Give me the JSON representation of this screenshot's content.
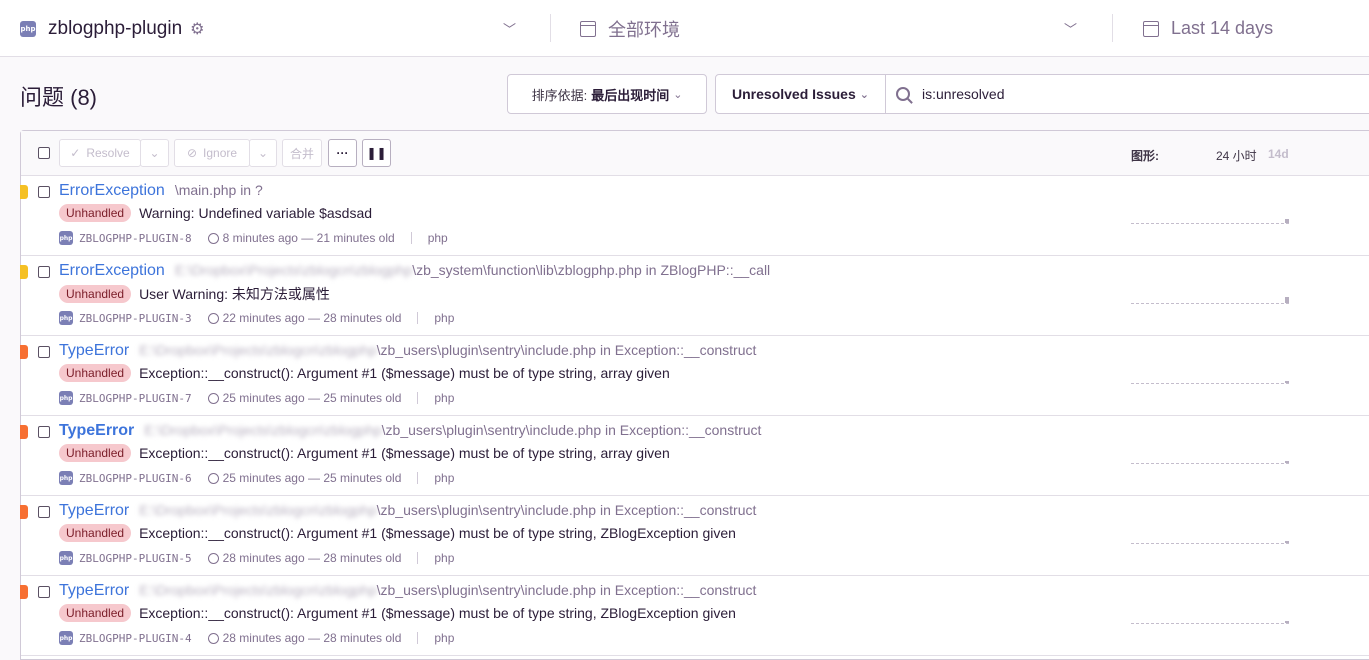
{
  "header": {
    "project_icon": "php-icon",
    "project_name": "zblogphp-plugin",
    "environment": "全部环境",
    "time_range": "Last 14 days"
  },
  "page": {
    "title": "问题 (8)"
  },
  "toolbar": {
    "sort_label": "排序依据:",
    "sort_value": "最后出现时间",
    "saved_search": "Unresolved Issues",
    "search_value": "is:unresolved"
  },
  "list_actions": {
    "resolve": "Resolve",
    "ignore": "Ignore",
    "merge": "合并",
    "more": "···",
    "graph_label": "图形:",
    "graph_24h": "24 小时",
    "graph_14d": "14d"
  },
  "colors": {
    "warning": "#f5c024",
    "error": "#f76f32",
    "link": "#3d74db",
    "badge_bg": "#f6c8cd"
  },
  "issues": [
    {
      "type": "ErrorException",
      "type_bold": false,
      "blurred": "",
      "culprit": "\\main.php in ?",
      "badge": "Unhandled",
      "message": "Warning: Undefined variable $asdsad",
      "short_id": "ZBLOGPHP-PLUGIN-8",
      "times": "8 minutes ago — 21 minutes old",
      "platform": "php",
      "level": "warning",
      "spark": 0.5
    },
    {
      "type": "ErrorException",
      "type_bold": false,
      "blurred": "E:\\Dropbox\\Projects\\zblogcn\\zblogphp",
      "culprit": "\\zb_system\\function\\lib\\zblogphp.php in ZBlogPHP::__call",
      "badge": "Unhandled",
      "message": "User Warning: 未知方法或属性",
      "short_id": "ZBLOGPHP-PLUGIN-3",
      "times": "22 minutes ago — 28 minutes old",
      "platform": "php",
      "level": "warning",
      "spark": 0.7
    },
    {
      "type": "TypeError",
      "type_bold": false,
      "blurred": "E:\\Dropbox\\Projects\\zblogcn\\zblogphp",
      "culprit": "\\zb_users\\plugin\\sentry\\include.php in Exception::__construct",
      "badge": "Unhandled",
      "message": "Exception::__construct(): Argument #1 ($message) must be of type string, array given",
      "short_id": "ZBLOGPHP-PLUGIN-7",
      "times": "25 minutes ago — 25 minutes old",
      "platform": "php",
      "level": "error",
      "spark": 0.2
    },
    {
      "type": "TypeError",
      "type_bold": true,
      "blurred": "E:\\Dropbox\\Projects\\zblogcn\\zblogphp",
      "culprit": "\\zb_users\\plugin\\sentry\\include.php in Exception::__construct",
      "badge": "Unhandled",
      "message": "Exception::__construct(): Argument #1 ($message) must be of type string, array given",
      "short_id": "ZBLOGPHP-PLUGIN-6",
      "times": "25 minutes ago — 25 minutes old",
      "platform": "php",
      "level": "error",
      "spark": 0.2
    },
    {
      "type": "TypeError",
      "type_bold": false,
      "blurred": "E:\\Dropbox\\Projects\\zblogcn\\zblogphp",
      "culprit": "\\zb_users\\plugin\\sentry\\include.php in Exception::__construct",
      "badge": "Unhandled",
      "message": "Exception::__construct(): Argument #1 ($message) must be of type string, ZBlogException given",
      "short_id": "ZBLOGPHP-PLUGIN-5",
      "times": "28 minutes ago — 28 minutes old",
      "platform": "php",
      "level": "error",
      "spark": 0.2
    },
    {
      "type": "TypeError",
      "type_bold": false,
      "blurred": "E:\\Dropbox\\Projects\\zblogcn\\zblogphp",
      "culprit": "\\zb_users\\plugin\\sentry\\include.php in Exception::__construct",
      "badge": "Unhandled",
      "message": "Exception::__construct(): Argument #1 ($message) must be of type string, ZBlogException given",
      "short_id": "ZBLOGPHP-PLUGIN-4",
      "times": "28 minutes ago — 28 minutes old",
      "platform": "php",
      "level": "error",
      "spark": 0.2
    }
  ]
}
